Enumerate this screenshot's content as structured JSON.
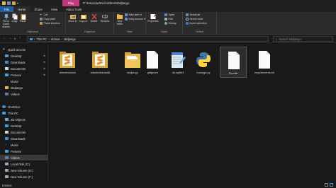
{
  "window": {
    "context_tab": "Play",
    "title": "C:\\Users\\admin\\Videos\\sbdjango"
  },
  "tabs": [
    "File",
    "Home",
    "Share",
    "View",
    "Video Tools"
  ],
  "ribbon": {
    "clipboard": {
      "pin_label": "Pin to Quick access",
      "copy_label": "Copy",
      "paste_label": "Paste",
      "cut_label": "Cut",
      "copy_path_label": "Copy path",
      "paste_shortcut_label": "Paste shortcut",
      "group_label": "Clipboard"
    },
    "organize": {
      "move_label": "Move to",
      "copy_label": "Copy to",
      "delete_label": "Delete",
      "rename_label": "Rename",
      "group_label": "Organize"
    },
    "new": {
      "new_folder_label": "New folder",
      "new_item_label": "New item",
      "easy_access_label": "Easy access",
      "group_label": "New"
    },
    "open": {
      "properties_label": "Properties",
      "open_label": "Open",
      "edit_label": "Edit",
      "history_label": "History",
      "group_label": "Open"
    },
    "select": {
      "select_all_label": "Select all",
      "select_none_label": "Select none",
      "invert_label": "Invert selection",
      "group_label": "Select"
    }
  },
  "address": {
    "crumbs": [
      "This PC",
      "Videos",
      "sbdjango"
    ],
    "search_placeholder": "Search sbdjango"
  },
  "nav": {
    "items": [
      {
        "label": "Quick access",
        "icon": "star-icon",
        "pinned": false
      },
      {
        "label": "Desktop",
        "icon": "desktop-icon",
        "pinned": true
      },
      {
        "label": "Downloads",
        "icon": "download-icon",
        "pinned": true
      },
      {
        "label": "Documents",
        "icon": "document-icon",
        "pinned": true
      },
      {
        "label": "Pictures",
        "icon": "picture-icon",
        "pinned": true
      },
      {
        "label": "Music",
        "icon": "music-icon",
        "pinned": false
      },
      {
        "label": "sbdjango",
        "icon": "folder-icon",
        "pinned": false
      },
      {
        "label": "Videos",
        "icon": "video-icon",
        "pinned": false
      },
      {
        "label": "OneDrive",
        "icon": "cloud-icon",
        "pinned": false
      },
      {
        "label": "This PC",
        "icon": "computer-icon",
        "pinned": false
      },
      {
        "label": "3D Objects",
        "icon": "cube-icon",
        "pinned": false
      },
      {
        "label": "Desktop",
        "icon": "desktop-icon",
        "pinned": false
      },
      {
        "label": "Documents",
        "icon": "document-icon",
        "pinned": false
      },
      {
        "label": "Downloads",
        "icon": "download-icon",
        "pinned": false
      },
      {
        "label": "Music",
        "icon": "music-icon",
        "pinned": false
      },
      {
        "label": "Pictures",
        "icon": "picture-icon",
        "pinned": false
      },
      {
        "label": "Videos",
        "icon": "video-icon",
        "pinned": false
      },
      {
        "label": "Local Disk (C:)",
        "icon": "drive-icon",
        "pinned": false
      },
      {
        "label": "New Volume (D:)",
        "icon": "drive-icon",
        "pinned": false
      },
      {
        "label": "New Volume (F:)",
        "icon": "drive-icon",
        "pinned": false
      }
    ]
  },
  "files": [
    {
      "name": ".ebextensions",
      "icon": "sublime-folder-icon"
    },
    {
      "name": ".elasticbeanstalk",
      "icon": "sublime-folder-icon"
    },
    {
      "name": "sbdjango",
      "icon": "folder-icon"
    },
    {
      "name": ".gitignore",
      "icon": "blank-file-icon"
    },
    {
      "name": "db.sqlite3",
      "icon": "notepad-file-icon"
    },
    {
      "name": "manage.py",
      "icon": "python-file-icon"
    },
    {
      "name": "Procfile",
      "icon": "blank-file-icon"
    },
    {
      "name": "requirements.txt",
      "icon": "blank-file-icon"
    }
  ],
  "status": {
    "count": "8 items"
  },
  "colors": {
    "accent": "#1f5fa8",
    "context_tab": "#c0397a",
    "folder": "#e8b84a",
    "sublime": "#f08c1a"
  }
}
